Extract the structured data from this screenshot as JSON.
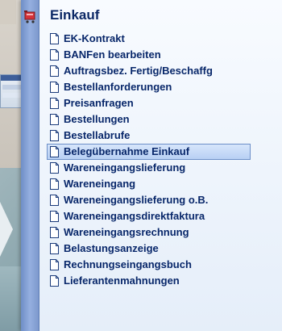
{
  "menu": {
    "title": "Einkauf",
    "items": [
      {
        "label": "EK-Kontrakt"
      },
      {
        "label": "BANFen bearbeiten"
      },
      {
        "label": "Auftragsbez. Fertig/Beschaffg"
      },
      {
        "label": "Bestellanforderungen"
      },
      {
        "label": "Preisanfragen"
      },
      {
        "label": "Bestellungen"
      },
      {
        "label": "Bestellabrufe"
      },
      {
        "label": "Belegübernahme Einkauf",
        "selected": true
      },
      {
        "label": "Wareneingangslieferung"
      },
      {
        "label": "Wareneingang"
      },
      {
        "label": "Wareneingangslieferung o.B."
      },
      {
        "label": "Wareneingangsdirektfaktura"
      },
      {
        "label": "Wareneingangsrechnung"
      },
      {
        "label": "Belastungsanzeige"
      },
      {
        "label": "Rechnungseingangsbuch"
      },
      {
        "label": "Lieferantenmahnungen"
      }
    ]
  },
  "colors": {
    "text": "#08276a",
    "selection": "#b8d0f4",
    "cart_icon": "#d5323a"
  },
  "icons": {
    "menu_icon": "shopping-cart-icon",
    "item_icon": "document-icon"
  }
}
